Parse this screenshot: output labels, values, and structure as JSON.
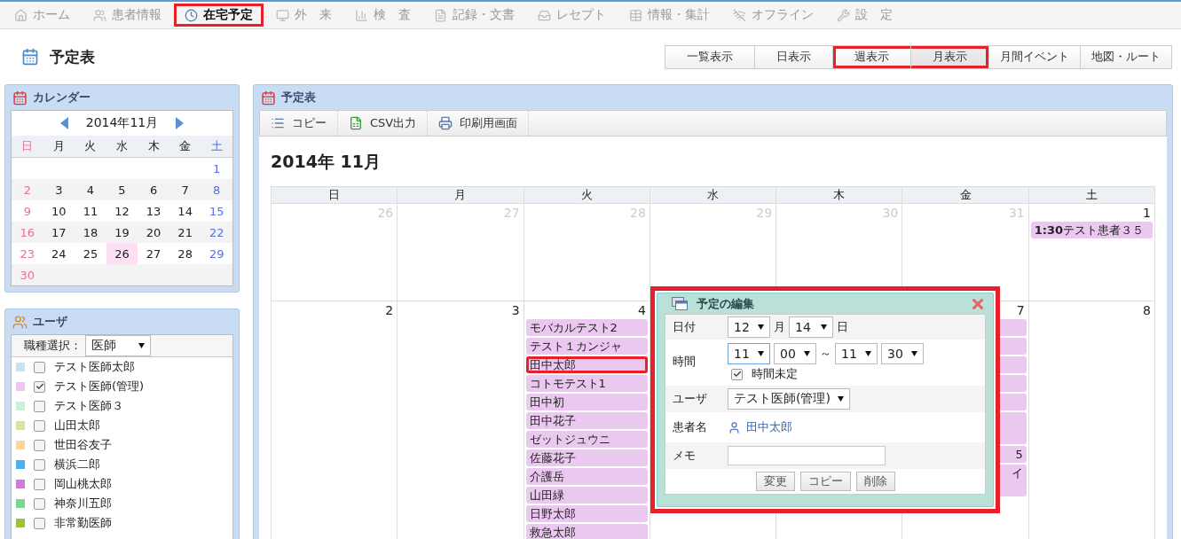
{
  "nav": [
    {
      "label": "ホーム",
      "selected": false,
      "highlighted": false
    },
    {
      "label": "患者情報",
      "selected": false,
      "highlighted": false
    },
    {
      "label": "在宅予定",
      "selected": true,
      "highlighted": true
    },
    {
      "label": "外　来",
      "selected": false,
      "highlighted": false
    },
    {
      "label": "検　査",
      "selected": false,
      "highlighted": false
    },
    {
      "label": "記録・文書",
      "selected": false,
      "highlighted": false
    },
    {
      "label": "レセプト",
      "selected": false,
      "highlighted": false
    },
    {
      "label": "情報・集計",
      "selected": false,
      "highlighted": false
    },
    {
      "label": "オフライン",
      "selected": false,
      "highlighted": false
    },
    {
      "label": "設　定",
      "selected": false,
      "highlighted": false
    }
  ],
  "page_title": "予定表",
  "view_buttons": [
    {
      "label": "一覧表示",
      "selected": false,
      "highlighted": false
    },
    {
      "label": "日表示",
      "selected": false,
      "highlighted": false
    },
    {
      "label": "週表示",
      "selected": false,
      "highlighted": true
    },
    {
      "label": "月表示",
      "selected": true,
      "highlighted": true
    },
    {
      "label": "月間イベント",
      "selected": false,
      "highlighted": false
    },
    {
      "label": "地図・ルート",
      "selected": false,
      "highlighted": false
    }
  ],
  "calendar_panel": {
    "title": "カレンダー",
    "month": "2014年11月",
    "weekdays": [
      "日",
      "月",
      "火",
      "水",
      "木",
      "金",
      "土"
    ],
    "weeks": [
      {
        "kind": "trailing",
        "days": [
          {
            "day": "1",
            "selected": false
          }
        ]
      },
      {
        "kind": "leading",
        "days": [
          {
            "day": "2",
            "selected": false
          },
          {
            "day": "3",
            "selected": false
          },
          {
            "day": "4",
            "selected": false
          },
          {
            "day": "5",
            "selected": false
          },
          {
            "day": "6",
            "selected": false
          },
          {
            "day": "7",
            "selected": false
          },
          {
            "day": "8",
            "selected": false
          }
        ]
      },
      {
        "kind": "leading",
        "days": [
          {
            "day": "9",
            "selected": false
          },
          {
            "day": "10",
            "selected": false
          },
          {
            "day": "11",
            "selected": false
          },
          {
            "day": "12",
            "selected": false
          },
          {
            "day": "13",
            "selected": false
          },
          {
            "day": "14",
            "selected": false
          },
          {
            "day": "15",
            "selected": false
          }
        ]
      },
      {
        "kind": "leading",
        "days": [
          {
            "day": "16",
            "selected": false
          },
          {
            "day": "17",
            "selected": false
          },
          {
            "day": "18",
            "selected": false
          },
          {
            "day": "19",
            "selected": false
          },
          {
            "day": "20",
            "selected": false
          },
          {
            "day": "21",
            "selected": false
          },
          {
            "day": "22",
            "selected": false
          }
        ]
      },
      {
        "kind": "leading",
        "days": [
          {
            "day": "23",
            "selected": false
          },
          {
            "day": "24",
            "selected": false
          },
          {
            "day": "25",
            "selected": false
          },
          {
            "day": "26",
            "selected": true
          },
          {
            "day": "27",
            "selected": false
          },
          {
            "day": "28",
            "selected": false
          },
          {
            "day": "29",
            "selected": false
          }
        ]
      },
      {
        "kind": "leading",
        "days": [
          {
            "day": "30",
            "selected": false
          }
        ]
      }
    ]
  },
  "user_panel": {
    "title": "ユーザ",
    "filter_label": "職種選択：",
    "filter_value": "医師",
    "users": [
      {
        "name": "テスト医師太郎",
        "color": "#c8e2f2",
        "checked": false
      },
      {
        "name": "テスト医師(管理)",
        "color": "#ecc8f0",
        "checked": true
      },
      {
        "name": "テスト医師３",
        "color": "#c8f2d8",
        "checked": false
      },
      {
        "name": "山田太郎",
        "color": "#d8e4a0",
        "checked": false
      },
      {
        "name": "世田谷友子",
        "color": "#ffd69a",
        "checked": false
      },
      {
        "name": "横浜二郎",
        "color": "#4cb0ee",
        "checked": false
      },
      {
        "name": "岡山桃太郎",
        "color": "#d07cd8",
        "checked": false
      },
      {
        "name": "神奈川五郎",
        "color": "#78d890",
        "checked": false
      },
      {
        "name": "非常勤医師",
        "color": "#a0c040",
        "checked": false
      }
    ]
  },
  "schedule": {
    "title": "予定表",
    "toolbar": [
      "コピー",
      "CSV出力",
      "印刷用画面"
    ],
    "month_title": "2014年 11月",
    "weekdays": [
      "日",
      "月",
      "火",
      "水",
      "木",
      "金",
      "土"
    ],
    "weeks": [
      [
        {
          "day": "26",
          "other_month": true
        },
        {
          "day": "27",
          "other_month": true
        },
        {
          "day": "28",
          "other_month": true
        },
        {
          "day": "29",
          "other_month": true
        },
        {
          "day": "30",
          "other_month": true
        },
        {
          "day": "31",
          "other_month": true
        },
        {
          "day": "1",
          "other_month": false,
          "events": [
            {
              "kind": "full",
              "time": "1:30",
              "text": "テスト患者３５",
              "highlighted": false
            }
          ]
        }
      ],
      [
        {
          "day": "2",
          "other_month": false
        },
        {
          "day": "3",
          "other_month": false
        },
        {
          "day": "4",
          "other_month": false,
          "events": [
            {
              "kind": "full",
              "text": "モバカルテスト2",
              "highlighted": false
            },
            {
              "kind": "full",
              "text": "テスト１カンジャ",
              "highlighted": false
            },
            {
              "kind": "full",
              "text": "田中太郎",
              "highlighted": true
            },
            {
              "kind": "full",
              "text": "コトモテスト1",
              "highlighted": false
            },
            {
              "kind": "full",
              "text": "田中初",
              "highlighted": false
            },
            {
              "kind": "full",
              "text": "田中花子",
              "highlighted": false
            },
            {
              "kind": "full",
              "text": "ゼットジュウニ",
              "highlighted": false
            },
            {
              "kind": "full",
              "text": "佐藤花子",
              "highlighted": false
            },
            {
              "kind": "full",
              "text": "介護岳",
              "highlighted": false
            },
            {
              "kind": "full",
              "text": "山田緑",
              "highlighted": false
            },
            {
              "kind": "full",
              "text": "日野太郎",
              "highlighted": false
            },
            {
              "kind": "full",
              "text": "救急太郎",
              "highlighted": false
            }
          ]
        },
        {
          "covered": true
        },
        {
          "covered": true
        },
        {
          "day": "7",
          "other_month": false,
          "events": [
            {
              "kind": "hidden",
              "highlighted": false
            },
            {
              "kind": "hidden",
              "highlighted": false
            },
            {
              "kind": "hidden",
              "highlighted": false
            },
            {
              "kind": "hidden",
              "highlighted": false
            },
            {
              "kind": "hidden",
              "highlighted": false
            },
            {
              "kind": "hidden-tall",
              "highlighted": false
            },
            {
              "kind": "cut",
              "text": "5",
              "highlighted": false
            },
            {
              "kind": "cut-tall",
              "text": "イ",
              "highlighted": false
            }
          ]
        },
        {
          "day": "8",
          "other_month": false
        }
      ]
    ]
  },
  "dialog": {
    "title": "予定の編集",
    "highlighted": true,
    "date_label": "日付",
    "month": "12",
    "month_unit": "月",
    "day": "14",
    "day_unit": "日",
    "time_label": "時間",
    "start_hour": {
      "value": "11",
      "focused": true
    },
    "start_minute": {
      "value": "00",
      "focused": false
    },
    "tilde": "～",
    "end_hour": {
      "value": "11",
      "focused": false
    },
    "end_minute": {
      "value": "30",
      "focused": false
    },
    "time_undecided": {
      "label": "時間未定",
      "checked": true
    },
    "user_label": "ユーザ",
    "user_value": "テスト医師(管理)",
    "patient_label": "患者名",
    "patient_name": "田中太郎",
    "memo_label": "メモ",
    "buttons": [
      "変更",
      "コピー",
      "削除"
    ]
  }
}
